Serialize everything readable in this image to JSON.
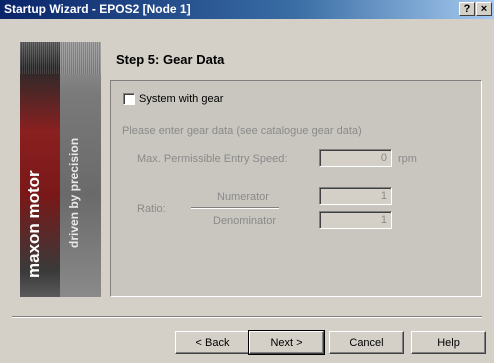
{
  "window": {
    "title": "Startup Wizard - EPOS2 [Node 1]",
    "help_glyph": "?",
    "close_glyph": "×"
  },
  "banner": {
    "brand": "maxon motor",
    "tagline": "driven by precision"
  },
  "step": {
    "title": "Step 5: Gear Data"
  },
  "gear": {
    "checkbox_label": "System with gear",
    "checked": false,
    "hint": "Please enter gear data (see catalogue gear data)",
    "max_speed_label": "Max. Permissible Entry Speed:",
    "max_speed_value": "0",
    "max_speed_unit": "rpm",
    "ratio_label": "Ratio:",
    "numerator_label": "Numerator",
    "numerator_value": "1",
    "denominator_label": "Denominator",
    "denominator_value": "1"
  },
  "buttons": {
    "back": "< Back",
    "next": "Next >",
    "cancel": "Cancel",
    "help": "Help"
  }
}
